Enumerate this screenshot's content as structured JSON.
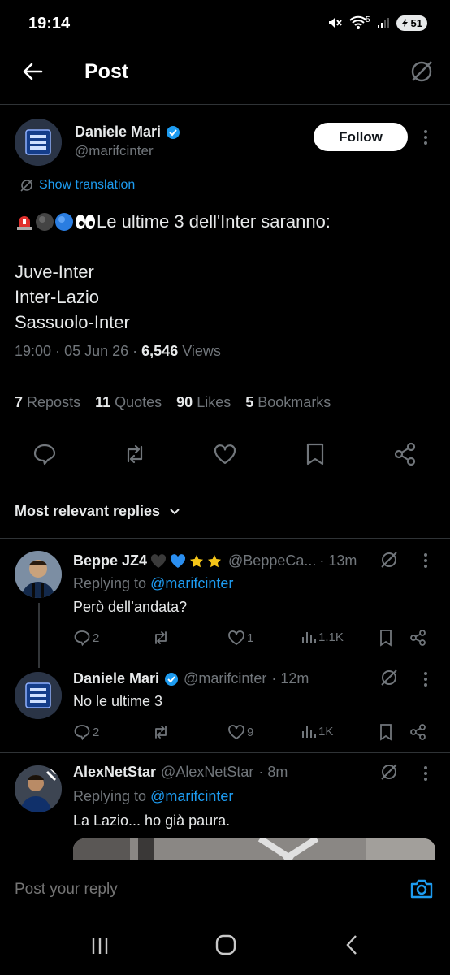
{
  "status_bar": {
    "time": "19:14",
    "battery": "51",
    "wifi_label": "5"
  },
  "header": {
    "title": "Post"
  },
  "post": {
    "author_name": "Daniele Mari",
    "author_handle": "@marifcinter",
    "follow_label": "Follow",
    "translation_label": "Show translation",
    "line1": "Le ultime 3 dell'Inter saranno:",
    "line2": "Juve-Inter",
    "line3": "Inter-Lazio",
    "line4": "Sassuolo-Inter",
    "time": "19:00",
    "date": "05 Jun 26",
    "views_count": "6,546",
    "views_label": "Views",
    "reposts_count": "7",
    "reposts_label": "Reposts",
    "quotes_count": "11",
    "quotes_label": "Quotes",
    "likes_count": "90",
    "likes_label": "Likes",
    "bookmarks_count": "5",
    "bookmarks_label": "Bookmarks"
  },
  "replies_header": "Most relevant replies",
  "replies": [
    {
      "name": "Beppe JZ4",
      "handle": "@BeppeCa...",
      "time": "· 13m",
      "replying_prefix": "Replying to",
      "replying_to": "@marifcinter",
      "text": "Però dell’andata?",
      "reply_count": "2",
      "like_count": "1",
      "view_count": "1.1K"
    },
    {
      "name": "Daniele Mari",
      "handle": "@marifcinter",
      "time": "· 12m",
      "text": "No le ultime 3",
      "reply_count": "2",
      "like_count": "9",
      "view_count": "1K"
    },
    {
      "name": "AlexNetStar",
      "handle": "@AlexNetStar",
      "time": "· 8m",
      "replying_prefix": "Replying to",
      "replying_to": "@marifcinter",
      "text": "La Lazio... ho già paura."
    }
  ],
  "reply_input": {
    "placeholder": "Post your reply"
  },
  "colors": {
    "accent": "#1d9bf0",
    "muted": "#71767b",
    "background": "#000000",
    "text": "#e7e9ea"
  }
}
